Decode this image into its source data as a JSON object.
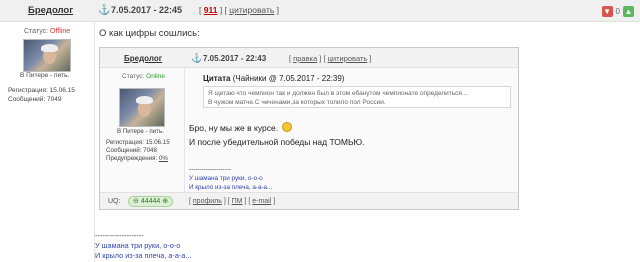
{
  "post": {
    "author": "Бредолог",
    "date": "7.05.2017 - 22:45",
    "number": "911",
    "quote_link": "цитировать",
    "votes_down": "0",
    "votes_up": "0",
    "status_label": "Статус:",
    "status_value": "Offline",
    "location": "В Питере - пить.",
    "registration": "Регистрация: 15.06.15",
    "messages": "Сообщений: 7049",
    "text": "О как цифры сошлись:",
    "signature_dashes": "--------------------",
    "signature_line1": "У шамана три руки, о-о-о",
    "signature_line2": "И крыло из-за плеча, а-а-а..."
  },
  "embedded": {
    "author": "Бредолог",
    "date": "7.05.2017 - 22:43",
    "edit_link": "правка",
    "quote_link": "цитировать",
    "status_label": "Статус:",
    "status_value": "Online",
    "location": "В Питере - пить.",
    "registration": "Регистрация: 15.06.15",
    "messages": "Сообщений: 7048",
    "warnings_label": "Предупреждения:",
    "warnings_value": "0%",
    "quote_title": "Цитата",
    "quote_source": "(Чайники @ 7.05.2017 - 22:39)",
    "quote_line1": "Я щетаю что чемпион так и должен был в этом ебанутом чемпионате определиться...",
    "quote_line2": "В чужом матче.С чеченами,за которых топило пол России.",
    "message_line1": "Бро, ну мы же в курсе.",
    "message_line2": "И после убедительной победы над ТОМЬЮ.",
    "signature_dashes": "--------------------",
    "signature_line1": "У шамана три руки, о-о-о",
    "signature_line2": "И крыло из-за плеча, а-а-а...",
    "uq_label": "UQ:",
    "uq_value": "44444",
    "profile_link": "профиль",
    "pm_link": "ПМ",
    "email_link": "e-mail"
  },
  "icons": {
    "anchor": "anchor-icon",
    "vote_down": "thumbs-down-icon",
    "vote_up": "thumbs-up-icon",
    "smile": "smile-icon"
  },
  "colors": {
    "offline": "#dd3333",
    "online": "#2a9d2a",
    "post_number": "#cc0000",
    "signature": "#3344aa"
  }
}
